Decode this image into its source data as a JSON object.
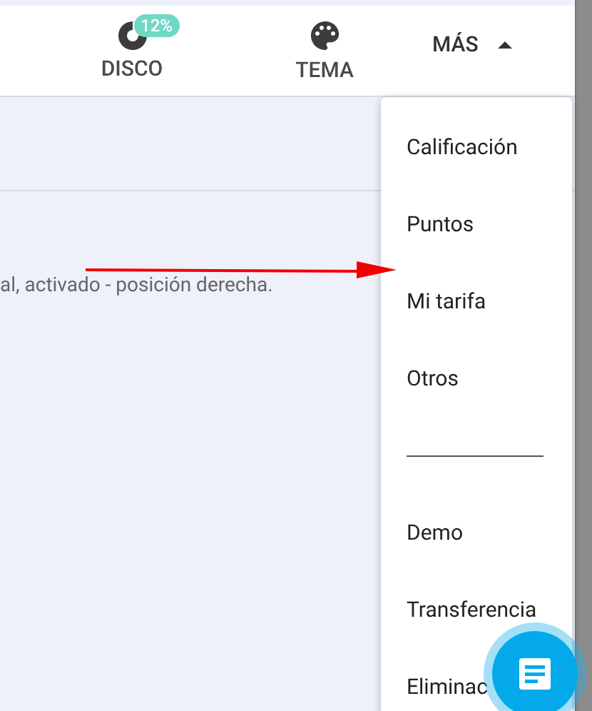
{
  "header": {
    "tabs": [
      {
        "kind": "disk",
        "label": "DISCO",
        "badge": "12%"
      },
      {
        "kind": "palette",
        "label": "TEMA"
      }
    ],
    "more": {
      "label": "MÁS",
      "expanded": true
    }
  },
  "content": {
    "text": "al, activado - posición derecha."
  },
  "menu": {
    "items": [
      {
        "kind": "item",
        "label": "Calificación"
      },
      {
        "kind": "item",
        "label": "Puntos"
      },
      {
        "kind": "item",
        "label": "Mi tarifa"
      },
      {
        "kind": "item",
        "label": "Otros"
      },
      {
        "kind": "divider"
      },
      {
        "kind": "item",
        "label": "Demo"
      },
      {
        "kind": "item",
        "label": "Transferencia"
      },
      {
        "kind": "item",
        "label": "Eliminac"
      }
    ]
  }
}
